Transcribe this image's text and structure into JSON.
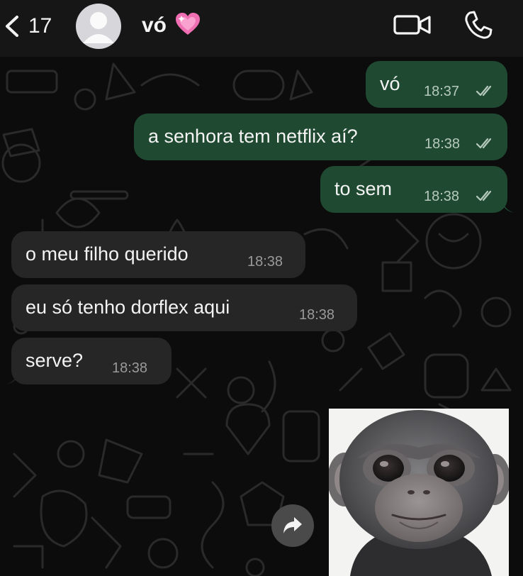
{
  "header": {
    "back_count": "17",
    "contact_name": "vó",
    "contact_emoji": "heart-pink",
    "avatar": "default-avatar-icon",
    "actions": [
      "video-call-icon",
      "phone-call-icon"
    ]
  },
  "messages": {
    "out_1": {
      "text": "vó",
      "time": "18:37",
      "status": "read"
    },
    "out_2": {
      "text": "a senhora tem netflix aí?",
      "time": "18:38",
      "status": "read"
    },
    "out_3": {
      "text": "to sem",
      "time": "18:38",
      "status": "read"
    },
    "in_1": {
      "text": "o meu filho querido",
      "time": "18:38"
    },
    "in_2": {
      "text": "eu só tenho dorflex aqui",
      "time": "18:38"
    },
    "in_3": {
      "text": "serve?",
      "time": "18:38"
    },
    "image": {
      "kind": "photo-sticker",
      "subject": "baby-monkey-face"
    }
  },
  "colors": {
    "outgoing_bubble": "#1f4a31",
    "incoming_bubble": "#262626",
    "background": "#0c0c0c",
    "header": "#161616"
  }
}
